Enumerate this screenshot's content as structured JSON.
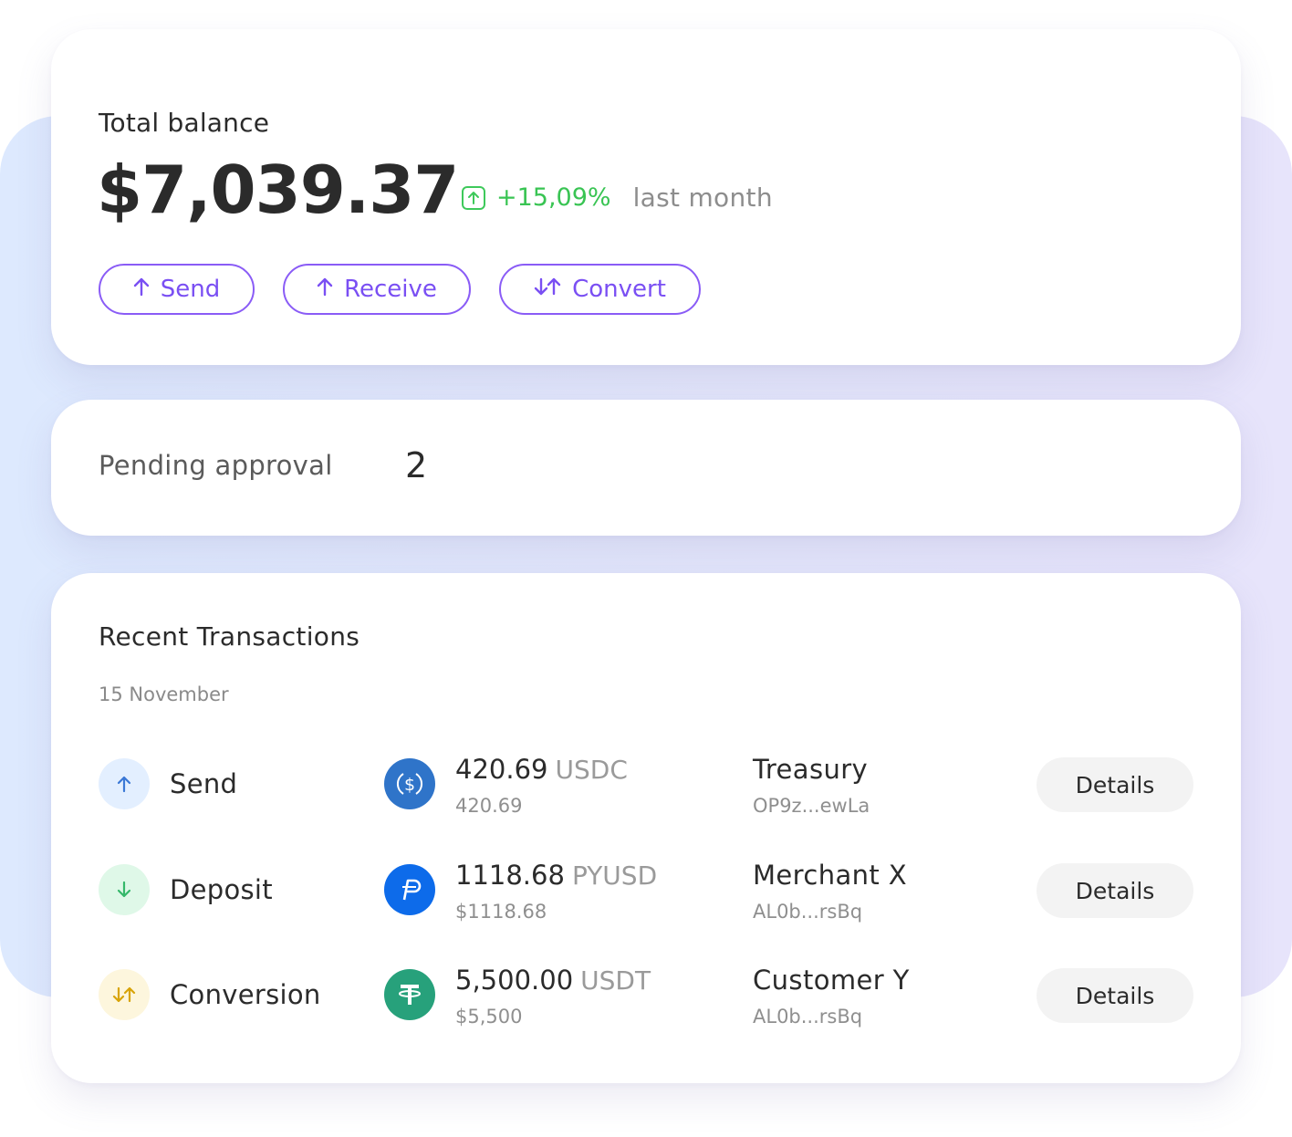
{
  "balance": {
    "title": "Total balance",
    "amount": "$7,039.37",
    "change_value": "+15,09%",
    "change_period": "last month",
    "actions": [
      {
        "label": "Send",
        "icon": "arrow-up-icon"
      },
      {
        "label": "Receive",
        "icon": "arrow-up-icon"
      },
      {
        "label": "Convert",
        "icon": "swap-vertical-icon"
      }
    ]
  },
  "pending": {
    "label": "Pending approval",
    "count": "2"
  },
  "transactions": {
    "title": "Recent Transactions",
    "date": "15 November",
    "details_label": "Details",
    "rows": [
      {
        "type": "Send",
        "type_icon": "arrow-up-icon",
        "amount": "420.69",
        "unit": "USDC",
        "sub_amount": "420.69",
        "token_icon": "usdc-icon",
        "party": "Treasury",
        "address": "OP9z...ewLa"
      },
      {
        "type": "Deposit",
        "type_icon": "arrow-down-icon",
        "amount": "1118.68",
        "unit": "PYUSD",
        "sub_amount": "$1118.68",
        "token_icon": "pyusd-icon",
        "party": "Merchant X",
        "address": "AL0b...rsBq"
      },
      {
        "type": "Conversion",
        "type_icon": "swap-vertical-icon",
        "amount": "5,500.00",
        "unit": "USDT",
        "sub_amount": "$5,500",
        "token_icon": "usdt-icon",
        "party": "Customer Y",
        "address": "AL0b...rsBq"
      }
    ]
  },
  "colors": {
    "accent": "#7a4ff3",
    "positive": "#39c453",
    "send_bg": "#e3efff",
    "send_fg": "#3a78d6",
    "deposit_bg": "#dff8e8",
    "deposit_fg": "#35b86a",
    "conversion_bg": "#fdf6dd",
    "conversion_fg": "#d8a408",
    "usdc": "#2f74c9",
    "pyusd": "#0d6bea",
    "usdt": "#27a17b"
  }
}
